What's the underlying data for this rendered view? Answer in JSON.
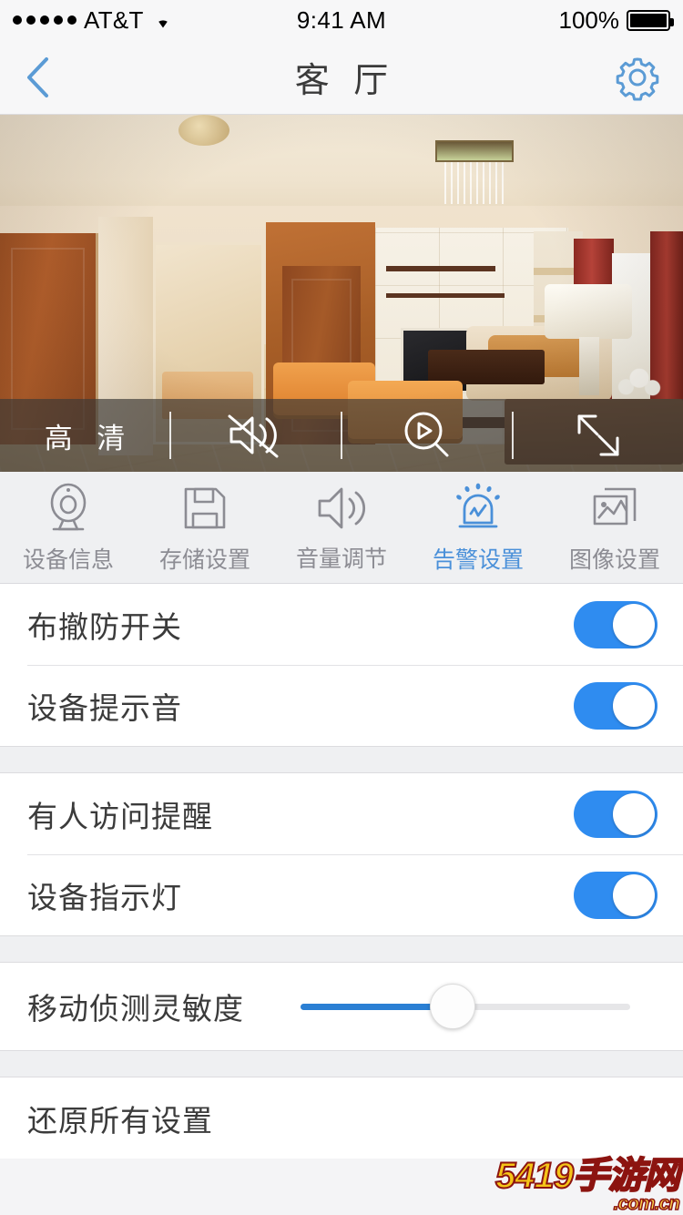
{
  "status_bar": {
    "carrier": "AT&T",
    "signal_dots": 5,
    "wifi_icon": "wifi-icon",
    "time": "9:41 AM",
    "battery_percent": "100%",
    "battery_level": 100
  },
  "nav_bar": {
    "back_icon": "chevron-left-icon",
    "title": "客 厅",
    "settings_icon": "gear-icon",
    "accent_color": "#5b9bd5"
  },
  "video": {
    "controls": [
      {
        "id": "hd",
        "type": "text",
        "label": "高 清",
        "icon": ""
      },
      {
        "id": "mute",
        "type": "icon",
        "label": "",
        "icon": "speaker-muted-icon"
      },
      {
        "id": "zoom",
        "type": "icon",
        "label": "",
        "icon": "magnifier-play-icon"
      },
      {
        "id": "fullscreen",
        "type": "icon",
        "label": "",
        "icon": "expand-arrows-icon"
      }
    ]
  },
  "tabs": [
    {
      "id": "device-info",
      "label": "设备信息",
      "icon": "camera-icon",
      "active": false
    },
    {
      "id": "storage",
      "label": "存储设置",
      "icon": "floppy-disk-icon",
      "active": false
    },
    {
      "id": "volume",
      "label": "音量调节",
      "icon": "speaker-icon",
      "active": false
    },
    {
      "id": "alarm",
      "label": "告警设置",
      "icon": "alarm-siren-icon",
      "active": true
    },
    {
      "id": "image",
      "label": "图像设置",
      "icon": "images-icon",
      "active": false
    }
  ],
  "settings": {
    "group1": [
      {
        "id": "arm-disarm",
        "label": "布撤防开关",
        "control": "switch",
        "value": "on"
      },
      {
        "id": "device-tone",
        "label": "设备提示音",
        "control": "switch",
        "value": "on"
      }
    ],
    "group2": [
      {
        "id": "visitor-alert",
        "label": "有人访问提醒",
        "control": "switch",
        "value": "on"
      },
      {
        "id": "indicator-led",
        "label": "设备指示灯",
        "control": "switch",
        "value": "on"
      }
    ],
    "group3": [
      {
        "id": "motion-sensitivity",
        "label": "移动侦测灵敏度",
        "control": "slider",
        "value": 46
      }
    ],
    "group4": [
      {
        "id": "restore-all",
        "label": "还原所有设置",
        "control": "none",
        "value": ""
      }
    ]
  },
  "watermark": {
    "main": "5419手游网",
    "sub": ".com.cn"
  },
  "colors": {
    "accent_blue": "#2f8cf0",
    "tab_active": "#4a90d9",
    "slider_fill": "#2a7fd4",
    "text_primary": "#3b3b3b",
    "text_muted": "#8c8c93",
    "page_bg": "#eff0f2"
  }
}
